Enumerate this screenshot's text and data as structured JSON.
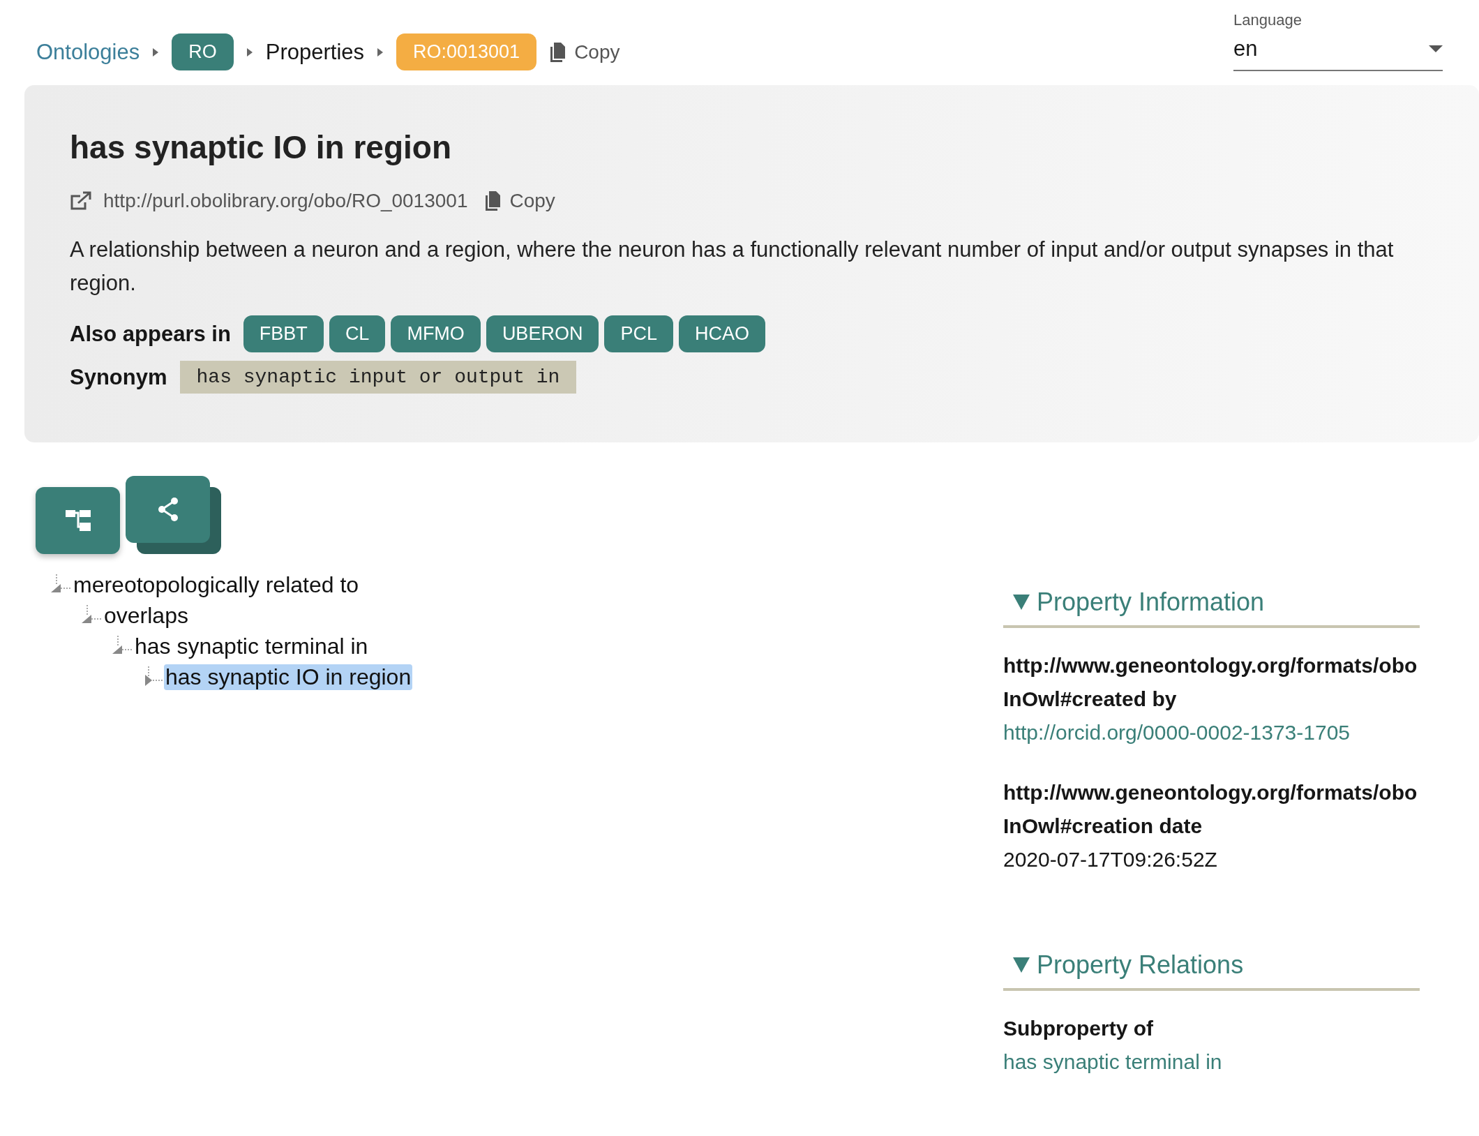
{
  "breadcrumb": [
    {
      "kind": "link",
      "label": "Ontologies"
    },
    {
      "kind": "badge",
      "label": "RO"
    },
    {
      "kind": "text",
      "label": "Properties"
    },
    {
      "kind": "id",
      "label": "RO:0013001"
    }
  ],
  "breadcrumb_copy": "Copy",
  "language": {
    "label": "Language",
    "value": "en"
  },
  "card": {
    "title": "has synaptic IO in region",
    "iri": "http://purl.obolibrary.org/obo/RO_0013001",
    "copy": "Copy",
    "description": "A relationship between a neuron and a region, where the neuron has a functionally relevant number of input and/or output synapses in that region.",
    "also_appears_label": "Also appears in",
    "ontologies": [
      "FBBT",
      "CL",
      "MFMO",
      "UBERON",
      "PCL",
      "HCAO"
    ],
    "synonym_label": "Synonym",
    "synonym": "has synaptic input or output in"
  },
  "view_buttons": [
    {
      "kind": "tree",
      "selected": true
    },
    {
      "kind": "graph",
      "selected": false
    }
  ],
  "tree": [
    {
      "label": "mereotopologically related to",
      "expanded": true,
      "selected": false,
      "children": [
        {
          "label": "overlaps",
          "expanded": true,
          "selected": false,
          "children": [
            {
              "label": "has synaptic terminal in",
              "expanded": true,
              "selected": false,
              "children": [
                {
                  "label": "has synaptic IO in region",
                  "expanded": false,
                  "selected": true
                }
              ]
            }
          ]
        }
      ]
    }
  ],
  "sections": [
    {
      "title": "Property Information",
      "expanded": true,
      "entries": [
        {
          "kind": "link",
          "label": "http://www.geneontology.org/formats/oboInOwl#created by",
          "value": "http://orcid.org/0000-0002-1373-1705"
        },
        {
          "kind": "text",
          "label": "http://www.geneontology.org/formats/oboInOwl#creation date",
          "value": "2020-07-17T09:26:52Z"
        }
      ]
    },
    {
      "title": "Property Relations",
      "expanded": true,
      "entries": [
        {
          "kind": "link",
          "label": "Subproperty of",
          "value": "has synaptic terminal in"
        }
      ]
    }
  ]
}
